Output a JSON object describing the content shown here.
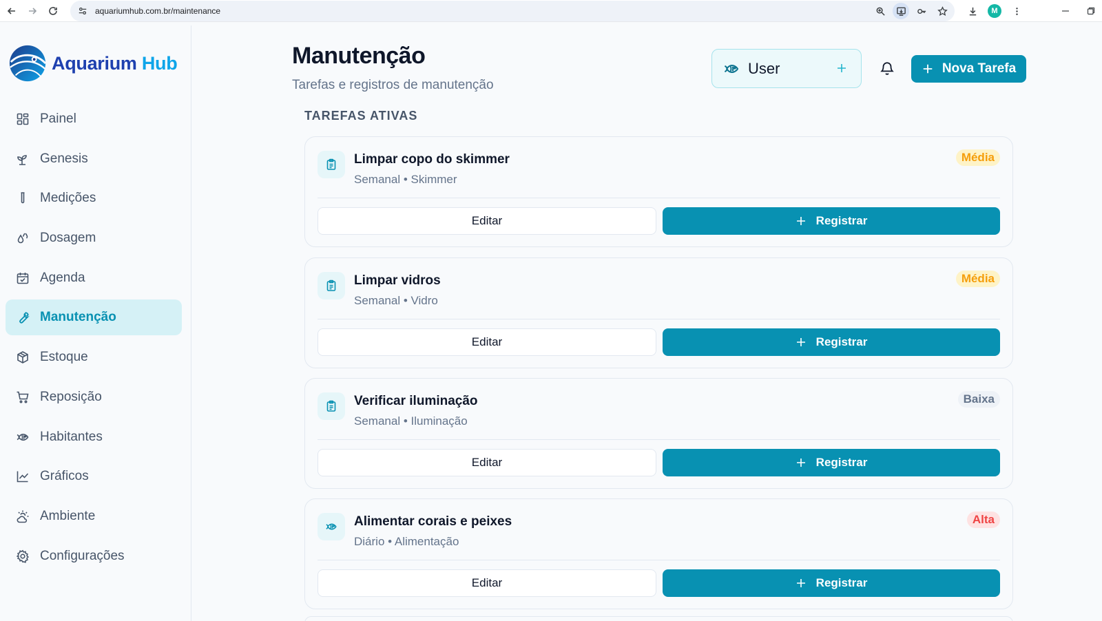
{
  "browser": {
    "url": "aquariumhub.com.br/maintenance",
    "profile_initial": "M"
  },
  "brand": {
    "name_part1": "Aquarium",
    "name_part2": "Hub"
  },
  "sidebar": {
    "items": [
      {
        "label": "Painel",
        "icon": "dashboard-icon"
      },
      {
        "label": "Genesis",
        "icon": "sprout-icon"
      },
      {
        "label": "Medições",
        "icon": "test-tube-icon"
      },
      {
        "label": "Dosagem",
        "icon": "droplets-icon"
      },
      {
        "label": "Agenda",
        "icon": "calendar-icon"
      },
      {
        "label": "Manutenção",
        "icon": "wrench-icon",
        "active": true
      },
      {
        "label": "Estoque",
        "icon": "package-icon"
      },
      {
        "label": "Reposição",
        "icon": "cart-icon"
      },
      {
        "label": "Habitantes",
        "icon": "fish-icon"
      },
      {
        "label": "Gráficos",
        "icon": "line-chart-icon"
      },
      {
        "label": "Ambiente",
        "icon": "weather-icon"
      },
      {
        "label": "Configurações",
        "icon": "gear-icon"
      }
    ]
  },
  "header": {
    "title": "Manutenção",
    "subtitle": "Tarefas e registros de manutenção",
    "user_label": "User",
    "new_task_label": "Nova Tarefa"
  },
  "section": {
    "title": "TAREFAS ATIVAS"
  },
  "tasks": [
    {
      "title": "Limpar copo do skimmer",
      "meta": "Semanal • Skimmer",
      "priority": "Média",
      "icon": "clipboard-icon",
      "edit": "Editar",
      "register": "Registrar"
    },
    {
      "title": "Limpar vidros",
      "meta": "Semanal • Vidro",
      "priority": "Média",
      "icon": "clipboard-icon",
      "edit": "Editar",
      "register": "Registrar"
    },
    {
      "title": "Verificar iluminação",
      "meta": "Semanal • Iluminação",
      "priority": "Baixa",
      "icon": "clipboard-icon",
      "edit": "Editar",
      "register": "Registrar"
    },
    {
      "title": "Alimentar corais e peixes",
      "meta": "Diário • Alimentação",
      "priority": "Alta",
      "icon": "fish-icon",
      "edit": "Editar",
      "register": "Registrar"
    }
  ],
  "colors": {
    "accent": "#0891b2",
    "active_nav_bg": "#d5f1f6",
    "badge_media": "#f59e0b",
    "badge_alta": "#ef4444",
    "badge_baixa": "#64748b"
  }
}
